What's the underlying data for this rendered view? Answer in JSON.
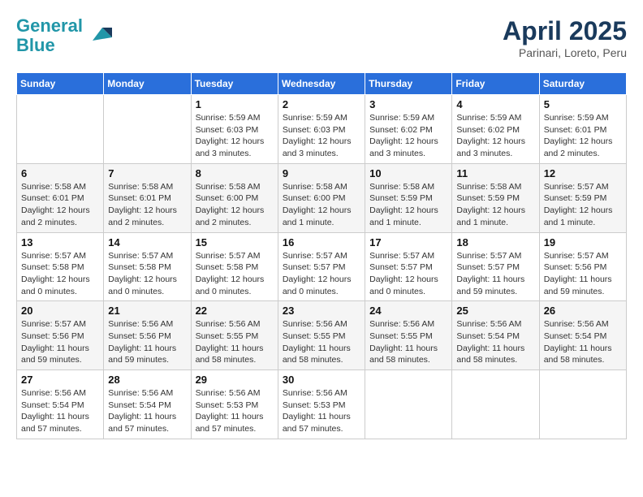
{
  "header": {
    "logo_line1": "General",
    "logo_line2": "Blue",
    "month_title": "April 2025",
    "subtitle": "Parinari, Loreto, Peru"
  },
  "weekdays": [
    "Sunday",
    "Monday",
    "Tuesday",
    "Wednesday",
    "Thursday",
    "Friday",
    "Saturday"
  ],
  "weeks": [
    [
      null,
      null,
      {
        "day": 1,
        "info": "Sunrise: 5:59 AM\nSunset: 6:03 PM\nDaylight: 12 hours\nand 3 minutes."
      },
      {
        "day": 2,
        "info": "Sunrise: 5:59 AM\nSunset: 6:03 PM\nDaylight: 12 hours\nand 3 minutes."
      },
      {
        "day": 3,
        "info": "Sunrise: 5:59 AM\nSunset: 6:02 PM\nDaylight: 12 hours\nand 3 minutes."
      },
      {
        "day": 4,
        "info": "Sunrise: 5:59 AM\nSunset: 6:02 PM\nDaylight: 12 hours\nand 3 minutes."
      },
      {
        "day": 5,
        "info": "Sunrise: 5:59 AM\nSunset: 6:01 PM\nDaylight: 12 hours\nand 2 minutes."
      }
    ],
    [
      {
        "day": 6,
        "info": "Sunrise: 5:58 AM\nSunset: 6:01 PM\nDaylight: 12 hours\nand 2 minutes."
      },
      {
        "day": 7,
        "info": "Sunrise: 5:58 AM\nSunset: 6:01 PM\nDaylight: 12 hours\nand 2 minutes."
      },
      {
        "day": 8,
        "info": "Sunrise: 5:58 AM\nSunset: 6:00 PM\nDaylight: 12 hours\nand 2 minutes."
      },
      {
        "day": 9,
        "info": "Sunrise: 5:58 AM\nSunset: 6:00 PM\nDaylight: 12 hours\nand 1 minute."
      },
      {
        "day": 10,
        "info": "Sunrise: 5:58 AM\nSunset: 5:59 PM\nDaylight: 12 hours\nand 1 minute."
      },
      {
        "day": 11,
        "info": "Sunrise: 5:58 AM\nSunset: 5:59 PM\nDaylight: 12 hours\nand 1 minute."
      },
      {
        "day": 12,
        "info": "Sunrise: 5:57 AM\nSunset: 5:59 PM\nDaylight: 12 hours\nand 1 minute."
      }
    ],
    [
      {
        "day": 13,
        "info": "Sunrise: 5:57 AM\nSunset: 5:58 PM\nDaylight: 12 hours\nand 0 minutes."
      },
      {
        "day": 14,
        "info": "Sunrise: 5:57 AM\nSunset: 5:58 PM\nDaylight: 12 hours\nand 0 minutes."
      },
      {
        "day": 15,
        "info": "Sunrise: 5:57 AM\nSunset: 5:58 PM\nDaylight: 12 hours\nand 0 minutes."
      },
      {
        "day": 16,
        "info": "Sunrise: 5:57 AM\nSunset: 5:57 PM\nDaylight: 12 hours\nand 0 minutes."
      },
      {
        "day": 17,
        "info": "Sunrise: 5:57 AM\nSunset: 5:57 PM\nDaylight: 12 hours\nand 0 minutes."
      },
      {
        "day": 18,
        "info": "Sunrise: 5:57 AM\nSunset: 5:57 PM\nDaylight: 11 hours\nand 59 minutes."
      },
      {
        "day": 19,
        "info": "Sunrise: 5:57 AM\nSunset: 5:56 PM\nDaylight: 11 hours\nand 59 minutes."
      }
    ],
    [
      {
        "day": 20,
        "info": "Sunrise: 5:57 AM\nSunset: 5:56 PM\nDaylight: 11 hours\nand 59 minutes."
      },
      {
        "day": 21,
        "info": "Sunrise: 5:56 AM\nSunset: 5:56 PM\nDaylight: 11 hours\nand 59 minutes."
      },
      {
        "day": 22,
        "info": "Sunrise: 5:56 AM\nSunset: 5:55 PM\nDaylight: 11 hours\nand 58 minutes."
      },
      {
        "day": 23,
        "info": "Sunrise: 5:56 AM\nSunset: 5:55 PM\nDaylight: 11 hours\nand 58 minutes."
      },
      {
        "day": 24,
        "info": "Sunrise: 5:56 AM\nSunset: 5:55 PM\nDaylight: 11 hours\nand 58 minutes."
      },
      {
        "day": 25,
        "info": "Sunrise: 5:56 AM\nSunset: 5:54 PM\nDaylight: 11 hours\nand 58 minutes."
      },
      {
        "day": 26,
        "info": "Sunrise: 5:56 AM\nSunset: 5:54 PM\nDaylight: 11 hours\nand 58 minutes."
      }
    ],
    [
      {
        "day": 27,
        "info": "Sunrise: 5:56 AM\nSunset: 5:54 PM\nDaylight: 11 hours\nand 57 minutes."
      },
      {
        "day": 28,
        "info": "Sunrise: 5:56 AM\nSunset: 5:54 PM\nDaylight: 11 hours\nand 57 minutes."
      },
      {
        "day": 29,
        "info": "Sunrise: 5:56 AM\nSunset: 5:53 PM\nDaylight: 11 hours\nand 57 minutes."
      },
      {
        "day": 30,
        "info": "Sunrise: 5:56 AM\nSunset: 5:53 PM\nDaylight: 11 hours\nand 57 minutes."
      },
      null,
      null,
      null
    ]
  ]
}
